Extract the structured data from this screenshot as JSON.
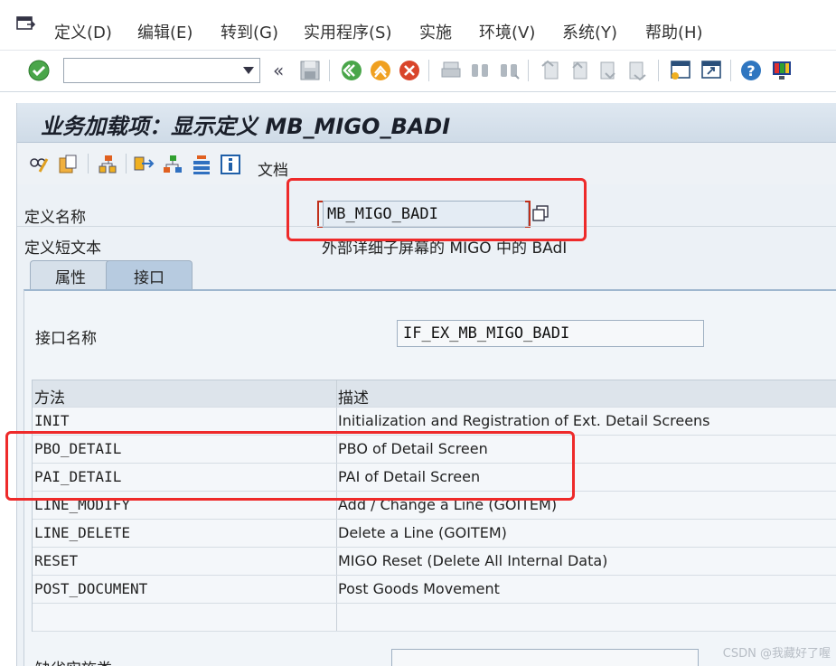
{
  "menu": {
    "items": [
      {
        "label": "定义(D)"
      },
      {
        "label": "编辑(E)"
      },
      {
        "label": "转到(G)"
      },
      {
        "label": "实用程序(S)"
      },
      {
        "label": "实施"
      },
      {
        "label": "环境(V)"
      },
      {
        "label": "系统(Y)"
      },
      {
        "label": "帮助(H)"
      }
    ]
  },
  "toolbar": {
    "command_field_value": "",
    "back_symbol": "«",
    "icons": [
      "enter-check-icon",
      "save-icon",
      "back-icon",
      "exit-icon",
      "cancel-icon",
      "print-icon",
      "find-icon",
      "find-next-icon",
      "first-page-icon",
      "prev-page-icon",
      "next-page-icon",
      "last-page-icon",
      "create-session-icon",
      "shortcut-icon",
      "help-icon",
      "customize-layout-icon"
    ]
  },
  "page": {
    "title": "业务加载项：显示定义 MB_MIGO_BADI",
    "doc_label": "文档"
  },
  "header": {
    "def_name_label": "定义名称",
    "def_name_value": "MB_MIGO_BADI",
    "short_text_label": "定义短文本",
    "short_text_value": "外部详细子屏幕的 MIGO 中的 BAdI"
  },
  "tabs": [
    {
      "label": "属性",
      "active": false
    },
    {
      "label": "接口",
      "active": true
    }
  ],
  "interface": {
    "name_label": "接口名称",
    "name_value": "IF_EX_MB_MIGO_BADI"
  },
  "methods": {
    "headers": {
      "method": "方法",
      "description": "描述"
    },
    "rows": [
      {
        "method": "INIT",
        "description": "Initialization and Registration of Ext. Detail Screens"
      },
      {
        "method": "PBO_DETAIL",
        "description": "PBO of Detail Screen"
      },
      {
        "method": "PAI_DETAIL",
        "description": "PAI of Detail Screen"
      },
      {
        "method": "LINE_MODIFY",
        "description": "Add / Change a Line (GOITEM)"
      },
      {
        "method": "LINE_DELETE",
        "description": "Delete a Line (GOITEM)"
      },
      {
        "method": "RESET",
        "description": "MIGO Reset (Delete All Internal Data)"
      },
      {
        "method": "POST_DOCUMENT",
        "description": "Post Goods Movement"
      },
      {
        "method": "",
        "description": ""
      }
    ]
  },
  "footer": {
    "impl_label": "缺省实施类",
    "watermark": "CSDN @我藏好了喔"
  },
  "colors": {
    "annotation": "#ee2a2a",
    "accent": "#b7cbe0"
  }
}
